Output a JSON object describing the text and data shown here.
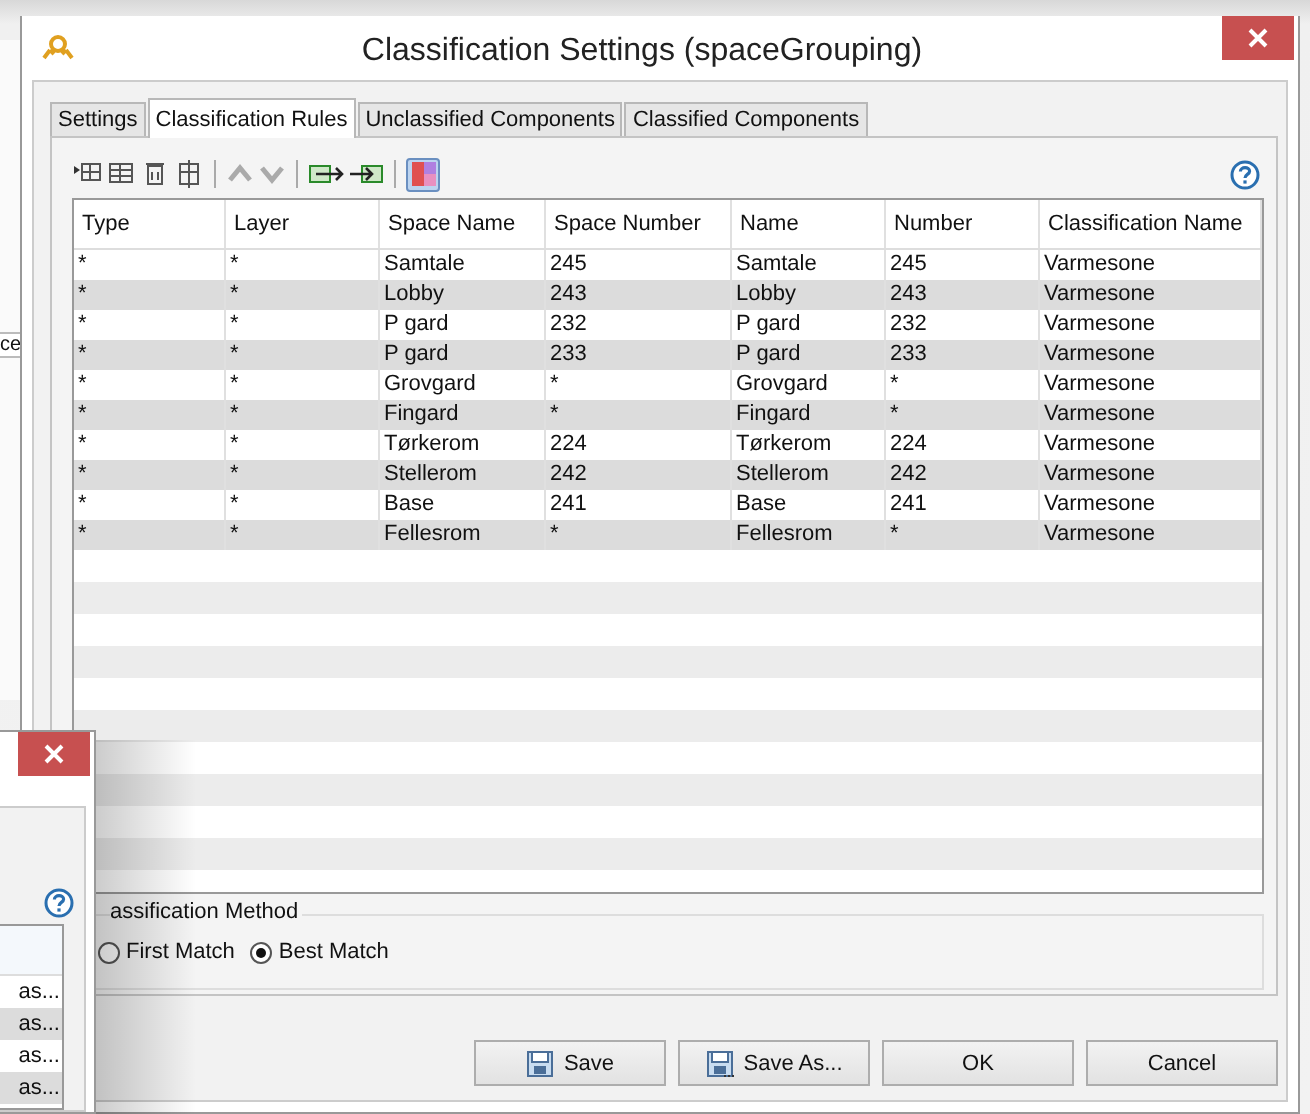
{
  "background_window": {
    "fragment_text": "ce"
  },
  "dialog": {
    "title": "Classification Settings (spaceGrouping)",
    "tabs": [
      {
        "label": "Settings",
        "selected": false
      },
      {
        "label": "Classification Rules",
        "selected": true
      },
      {
        "label": "Unclassified Components",
        "selected": false
      },
      {
        "label": "Classified Components",
        "selected": false
      }
    ],
    "toolbar": {
      "move_buttons_disabled": true,
      "color_toggle_on": true
    },
    "table": {
      "columns": [
        "Type",
        "Layer",
        "Space Name",
        "Space Number",
        "Name",
        "Number",
        "Classification Name"
      ],
      "rows": [
        [
          "*",
          "*",
          "Samtale",
          "245",
          "Samtale",
          "245",
          "Varmesone"
        ],
        [
          "*",
          "*",
          "Lobby",
          "243",
          "Lobby",
          "243",
          "Varmesone"
        ],
        [
          "*",
          "*",
          "P gard",
          "232",
          "P gard",
          "232",
          "Varmesone"
        ],
        [
          "*",
          "*",
          "P gard",
          "233",
          "P gard",
          "233",
          "Varmesone"
        ],
        [
          "*",
          "*",
          "Grovgard",
          "*",
          "Grovgard",
          "*",
          "Varmesone"
        ],
        [
          "*",
          "*",
          "Fingard",
          "*",
          "Fingard",
          "*",
          "Varmesone"
        ],
        [
          "*",
          "*",
          "Tørkerom",
          "224",
          "Tørkerom",
          "224",
          "Varmesone"
        ],
        [
          "*",
          "*",
          "Stellerom",
          "242",
          "Stellerom",
          "242",
          "Varmesone"
        ],
        [
          "*",
          "*",
          "Base",
          "241",
          "Base",
          "241",
          "Varmesone"
        ],
        [
          "*",
          "*",
          "Fellesrom",
          "*",
          "Fellesrom",
          "*",
          "Varmesone"
        ]
      ]
    },
    "method": {
      "legend": "assification Method",
      "options": [
        {
          "label": "First Match",
          "selected": false
        },
        {
          "label": "Best Match",
          "selected": true
        }
      ]
    },
    "buttons": [
      {
        "kind": "save",
        "label": "Save"
      },
      {
        "kind": "saveas",
        "label": "Save As..."
      },
      {
        "kind": "plain",
        "label": "OK"
      },
      {
        "kind": "plain",
        "label": "Cancel"
      }
    ]
  },
  "front_window": {
    "rows": [
      "as...",
      "as...",
      "as...",
      "as..."
    ]
  }
}
